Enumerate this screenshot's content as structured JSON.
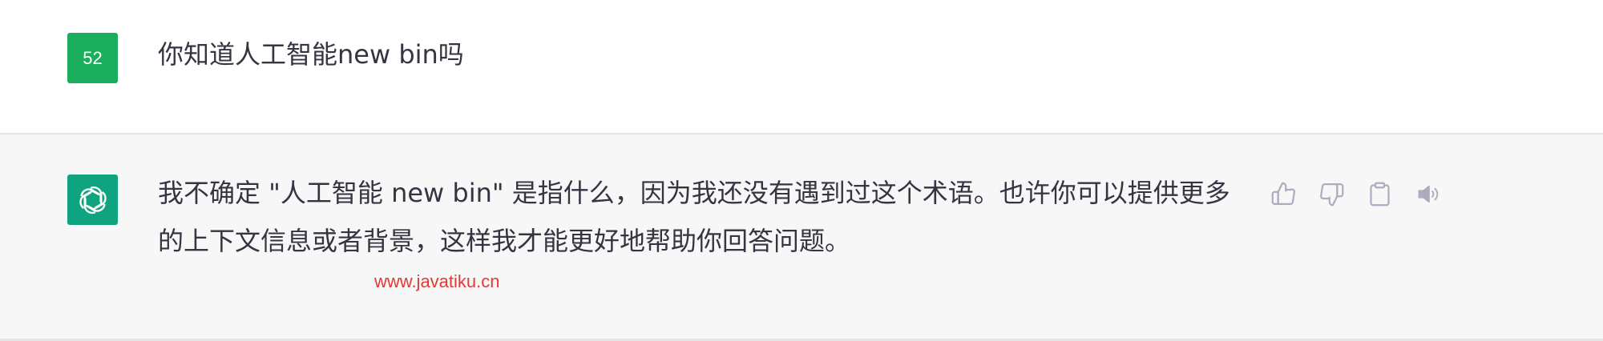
{
  "user_message": {
    "avatar_label": "52",
    "text": "你知道人工智能new bin吗"
  },
  "assistant_message": {
    "avatar_icon": "openai-logo-icon",
    "text": "我不确定 \"人工智能 new bin\" 是指什么，因为我还没有遇到过这个术语。也许你可以提供更多的上下文信息或者背景，这样我才能更好地帮助你回答问题。",
    "actions": [
      {
        "icon": "thumbs-up-icon"
      },
      {
        "icon": "thumbs-down-icon"
      },
      {
        "icon": "clipboard-icon"
      },
      {
        "icon": "speaker-icon"
      }
    ]
  },
  "watermark": "www.javatiku.cn",
  "colors": {
    "user_avatar": "#1aae5c",
    "assistant_avatar": "#10a37f",
    "assistant_bg": "#f7f7f8",
    "text": "#343541",
    "icon": "#acacbe",
    "watermark": "#e53935"
  }
}
